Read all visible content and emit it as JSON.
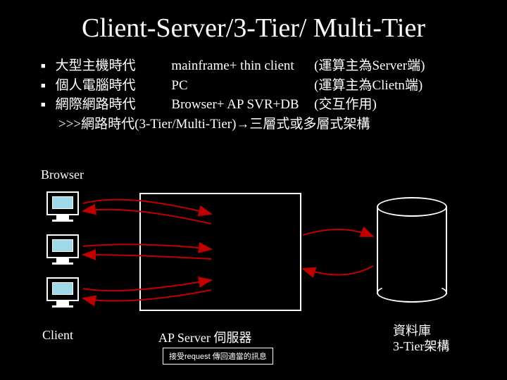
{
  "title": "Client-Server/3-Tier/ Multi-Tier",
  "bullets": {
    "row0": {
      "era": "大型主機時代",
      "tech": "mainframe+ thin client",
      "note": "(運算主為Server端)"
    },
    "row1": {
      "era": "個人電腦時代",
      "tech": "PC",
      "note": "(運算主為Clietn端)"
    },
    "row2": {
      "era": "網際網路時代",
      "tech": "Browser+ AP SVR+DB",
      "note": "(交互作用)"
    },
    "continuation": ">>>網路時代(3-Tier/Multi-Tier)→三層式或多層式架構"
  },
  "diagram": {
    "browser_label": "Browser",
    "client_label": "Client",
    "ap_label": "AP Server 伺服器",
    "db_label1": "資料庫",
    "db_label2": "3-Tier架構",
    "caption": "接受request 傳回適當的訊息"
  },
  "chart_data": {
    "type": "diagram",
    "title": "Client-Server/3-Tier/ Multi-Tier",
    "nodes": [
      {
        "id": "browser",
        "label": "Browser",
        "count": 3
      },
      {
        "id": "client",
        "label": "Client"
      },
      {
        "id": "ap_server",
        "label": "AP Server 伺服器"
      },
      {
        "id": "database",
        "label": "資料庫"
      }
    ],
    "edges": [
      {
        "from": "browser",
        "to": "ap_server",
        "bidirectional": true
      },
      {
        "from": "ap_server",
        "to": "database",
        "bidirectional": true
      }
    ],
    "architecture": "3-Tier架構",
    "caption": "接受request 傳回適當的訊息"
  }
}
